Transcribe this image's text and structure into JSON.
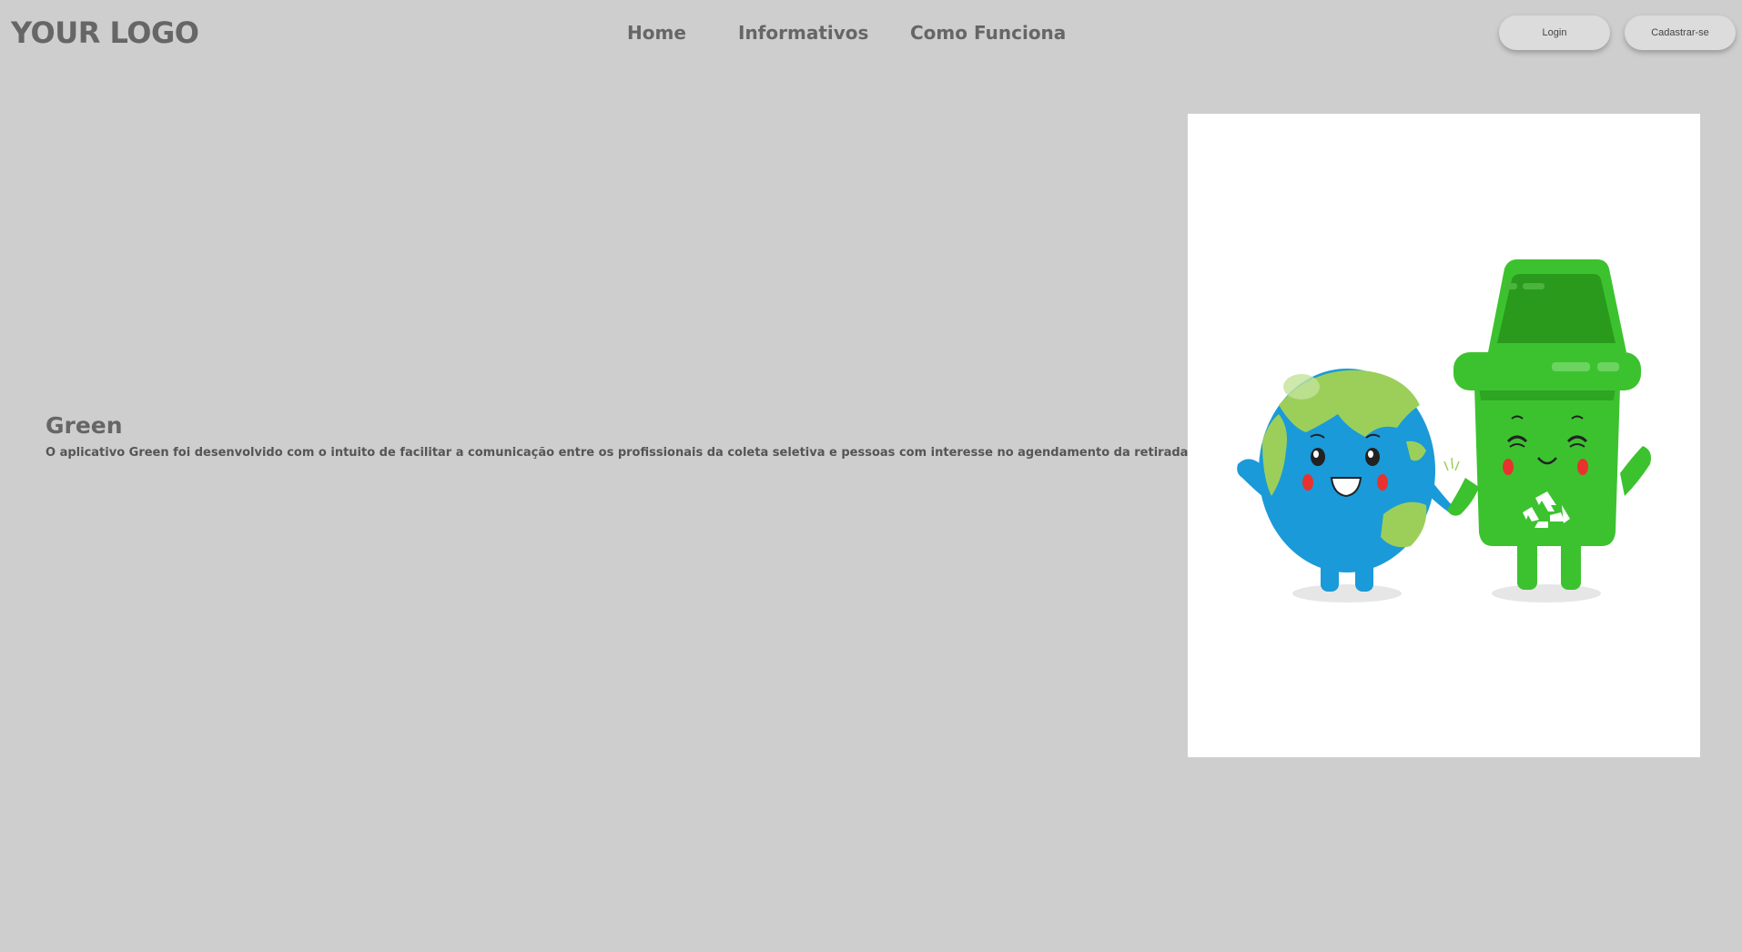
{
  "header": {
    "logo": "YOUR LOGO",
    "nav": {
      "home": "Home",
      "informativos": "Informativos",
      "como_funciona": "Como Funciona"
    },
    "login_label": "Login",
    "signup_label": "Cadastrar-se"
  },
  "hero": {
    "title": "Green",
    "description": "O aplicativo Green foi desenvolvido com o intuito de facilitar a comunicação entre os profissionais da coleta seletiva e pessoas com interesse no agendamento da retirada de materiais."
  },
  "colors": {
    "background": "#cecece",
    "text": "#666666",
    "earth_blue": "#1a9ad9",
    "earth_green": "#9ccf5a",
    "bin_green": "#3cc22f",
    "bin_dark_green": "#2a9a1d"
  },
  "illustration": {
    "icon": "earth-and-recycle-bin-illustration"
  }
}
